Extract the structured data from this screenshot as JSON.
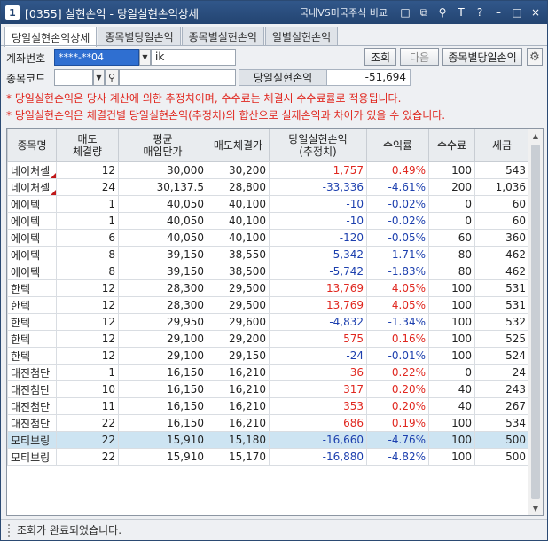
{
  "window": {
    "number": "1",
    "title": "[0355] 실현손익 - 당일실현손익상세",
    "compare_link": "국내VS미국주식 비교",
    "buttons": [
      "□",
      "⧉",
      "⚲",
      "T",
      "?",
      "–",
      "□",
      "×"
    ]
  },
  "tabs": [
    {
      "label": "당일실현손익상세",
      "active": true
    },
    {
      "label": "종목별당일손익",
      "active": false
    },
    {
      "label": "종목별실현손익",
      "active": false
    },
    {
      "label": "일별실현손익",
      "active": false
    }
  ],
  "form": {
    "account_label": "계좌번호",
    "account_value": "****-**04",
    "account_name": "ik",
    "search_button": "조회",
    "next_button": "다음",
    "by_stock_button": "종목별당일손익",
    "stock_code_label": "종목코드",
    "stock_code_value": "",
    "stock_name_value": "",
    "sum_label": "당일실현손익",
    "sum_value": "-51,694"
  },
  "notes": [
    "* 당일실현손익은 당사 계산에 의한 추정치이며, 수수료는 체결시 수수료률로 적용됩니다.",
    "* 당일실현손익은 체결건별 당일실현손익(추정치)의 합산으로 실제손익과 차이가 있을 수 있습니다."
  ],
  "table": {
    "headers": [
      "종목명",
      "매도\n체결량",
      "평균\n매입단가",
      "매도체결가",
      "당일실현손익\n(추정치)",
      "수익률",
      "수수료",
      "세금"
    ],
    "rows": [
      {
        "name": "네이처셀",
        "qty": "12",
        "avg": "30,000",
        "sell": "30,200",
        "pnl": "1,757",
        "rate": "0.49%",
        "fee": "100",
        "tax": "543",
        "sign": "pos",
        "flag": true
      },
      {
        "name": "네이처셀",
        "qty": "24",
        "avg": "30,137.5",
        "sell": "28,800",
        "pnl": "-33,336",
        "rate": "-4.61%",
        "fee": "200",
        "tax": "1,036",
        "sign": "neg",
        "flag": true
      },
      {
        "name": "에이텍",
        "qty": "1",
        "avg": "40,050",
        "sell": "40,100",
        "pnl": "-10",
        "rate": "-0.02%",
        "fee": "0",
        "tax": "60",
        "sign": "neg"
      },
      {
        "name": "에이텍",
        "qty": "1",
        "avg": "40,050",
        "sell": "40,100",
        "pnl": "-10",
        "rate": "-0.02%",
        "fee": "0",
        "tax": "60",
        "sign": "neg"
      },
      {
        "name": "에이텍",
        "qty": "6",
        "avg": "40,050",
        "sell": "40,100",
        "pnl": "-120",
        "rate": "-0.05%",
        "fee": "60",
        "tax": "360",
        "sign": "neg"
      },
      {
        "name": "에이텍",
        "qty": "8",
        "avg": "39,150",
        "sell": "38,550",
        "pnl": "-5,342",
        "rate": "-1.71%",
        "fee": "80",
        "tax": "462",
        "sign": "neg"
      },
      {
        "name": "에이텍",
        "qty": "8",
        "avg": "39,150",
        "sell": "38,500",
        "pnl": "-5,742",
        "rate": "-1.83%",
        "fee": "80",
        "tax": "462",
        "sign": "neg"
      },
      {
        "name": "한텍",
        "qty": "12",
        "avg": "28,300",
        "sell": "29,500",
        "pnl": "13,769",
        "rate": "4.05%",
        "fee": "100",
        "tax": "531",
        "sign": "pos"
      },
      {
        "name": "한텍",
        "qty": "12",
        "avg": "28,300",
        "sell": "29,500",
        "pnl": "13,769",
        "rate": "4.05%",
        "fee": "100",
        "tax": "531",
        "sign": "pos"
      },
      {
        "name": "한텍",
        "qty": "12",
        "avg": "29,950",
        "sell": "29,600",
        "pnl": "-4,832",
        "rate": "-1.34%",
        "fee": "100",
        "tax": "532",
        "sign": "neg"
      },
      {
        "name": "한텍",
        "qty": "12",
        "avg": "29,100",
        "sell": "29,200",
        "pnl": "575",
        "rate": "0.16%",
        "fee": "100",
        "tax": "525",
        "sign": "pos"
      },
      {
        "name": "한텍",
        "qty": "12",
        "avg": "29,100",
        "sell": "29,150",
        "pnl": "-24",
        "rate": "-0.01%",
        "fee": "100",
        "tax": "524",
        "sign": "neg"
      },
      {
        "name": "대진첨단",
        "qty": "1",
        "avg": "16,150",
        "sell": "16,210",
        "pnl": "36",
        "rate": "0.22%",
        "fee": "0",
        "tax": "24",
        "sign": "pos"
      },
      {
        "name": "대진첨단",
        "qty": "10",
        "avg": "16,150",
        "sell": "16,210",
        "pnl": "317",
        "rate": "0.20%",
        "fee": "40",
        "tax": "243",
        "sign": "pos"
      },
      {
        "name": "대진첨단",
        "qty": "11",
        "avg": "16,150",
        "sell": "16,210",
        "pnl": "353",
        "rate": "0.20%",
        "fee": "40",
        "tax": "267",
        "sign": "pos"
      },
      {
        "name": "대진첨단",
        "qty": "22",
        "avg": "16,150",
        "sell": "16,210",
        "pnl": "686",
        "rate": "0.19%",
        "fee": "100",
        "tax": "534",
        "sign": "pos"
      },
      {
        "name": "모티브링",
        "qty": "22",
        "avg": "15,910",
        "sell": "15,180",
        "pnl": "-16,660",
        "rate": "-4.76%",
        "fee": "100",
        "tax": "500",
        "sign": "neg",
        "selected": true
      },
      {
        "name": "모티브링",
        "qty": "22",
        "avg": "15,910",
        "sell": "15,170",
        "pnl": "-16,880",
        "rate": "-4.82%",
        "fee": "100",
        "tax": "500",
        "sign": "neg"
      }
    ]
  },
  "status": {
    "message": "조회가 완료되었습니다."
  },
  "colors": {
    "positive": "#e0271f",
    "negative": "#1c3fae",
    "selected_row": "#cde4f2"
  }
}
